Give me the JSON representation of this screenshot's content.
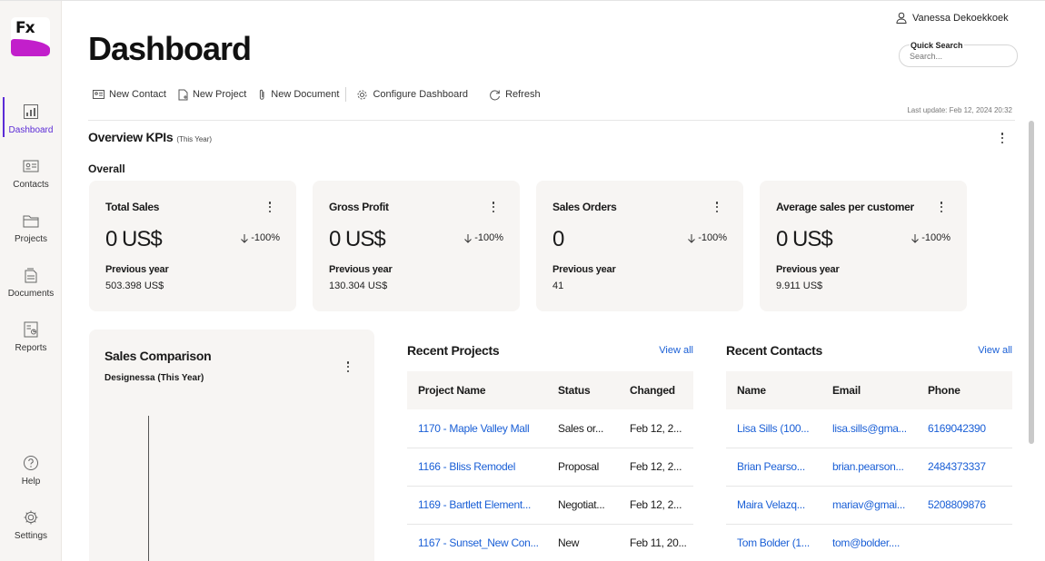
{
  "app": {
    "logo_text": "Fx",
    "brand_color": "#c21fcb",
    "accent_color": "#5b2bd6"
  },
  "user": {
    "name": "Vanessa Dekoekkoek",
    "icon": "user-icon"
  },
  "sidebar": {
    "items": [
      {
        "label": "Dashboard",
        "icon": "dashboard-icon",
        "active": true
      },
      {
        "label": "Contacts",
        "icon": "contact-card-icon"
      },
      {
        "label": "Projects",
        "icon": "folder-icon"
      },
      {
        "label": "Documents",
        "icon": "document-icon"
      },
      {
        "label": "Reports",
        "icon": "report-icon"
      }
    ],
    "bottom": [
      {
        "label": "Help",
        "icon": "help-icon"
      },
      {
        "label": "Settings",
        "icon": "gear-icon"
      }
    ]
  },
  "header": {
    "title": "Dashboard"
  },
  "search": {
    "label": "Quick Search",
    "placeholder": "Search..."
  },
  "toolbar": {
    "new_contact": "New Contact",
    "new_project": "New Project",
    "new_document": "New Document",
    "configure": "Configure Dashboard",
    "refresh": "Refresh"
  },
  "last_update": "Last update: Feb 12, 2024 20:32",
  "kpis": {
    "title": "Overview KPIs",
    "period": "(This Year)",
    "group": "Overall",
    "cards": [
      {
        "title": "Total Sales",
        "value": "0 US$",
        "change": "-100%",
        "prev_label": "Previous year",
        "prev_value": "503.398 US$"
      },
      {
        "title": "Gross Profit",
        "value": "0 US$",
        "change": "-100%",
        "prev_label": "Previous year",
        "prev_value": "130.304 US$"
      },
      {
        "title": "Sales Orders",
        "value": "0",
        "change": "-100%",
        "prev_label": "Previous year",
        "prev_value": "41"
      },
      {
        "title": "Average sales per customer",
        "value": "0 US$",
        "change": "-100%",
        "prev_label": "Previous year",
        "prev_value": "9.911 US$"
      }
    ]
  },
  "sales_comparison": {
    "title": "Sales Comparison",
    "subtitle": "Designessa (This Year)"
  },
  "recent_projects": {
    "title": "Recent Projects",
    "view_all": "View all",
    "columns": [
      "Project Name",
      "Status",
      "Changed"
    ],
    "rows": [
      [
        "1170 - Maple Valley Mall",
        "Sales or...",
        "Feb 12, 2..."
      ],
      [
        "1166 - Bliss Remodel",
        "Proposal",
        "Feb 12, 2..."
      ],
      [
        "1169 - Bartlett Element...",
        "Negotiat...",
        "Feb 12, 2..."
      ],
      [
        "1167 - Sunset_New Con...",
        "New",
        "Feb 11, 20..."
      ]
    ]
  },
  "recent_contacts": {
    "title": "Recent Contacts",
    "view_all": "View all",
    "columns": [
      "Name",
      "Email",
      "Phone"
    ],
    "rows": [
      [
        "Lisa Sills (100...",
        "lisa.sills@gma...",
        "6169042390"
      ],
      [
        "Brian Pearso...",
        "brian.pearson...",
        "2484373337"
      ],
      [
        "Maira Velazq...",
        "mariav@gmai...",
        "5208809876"
      ],
      [
        "Tom Bolder (1...",
        "tom@bolder....",
        ""
      ]
    ]
  }
}
